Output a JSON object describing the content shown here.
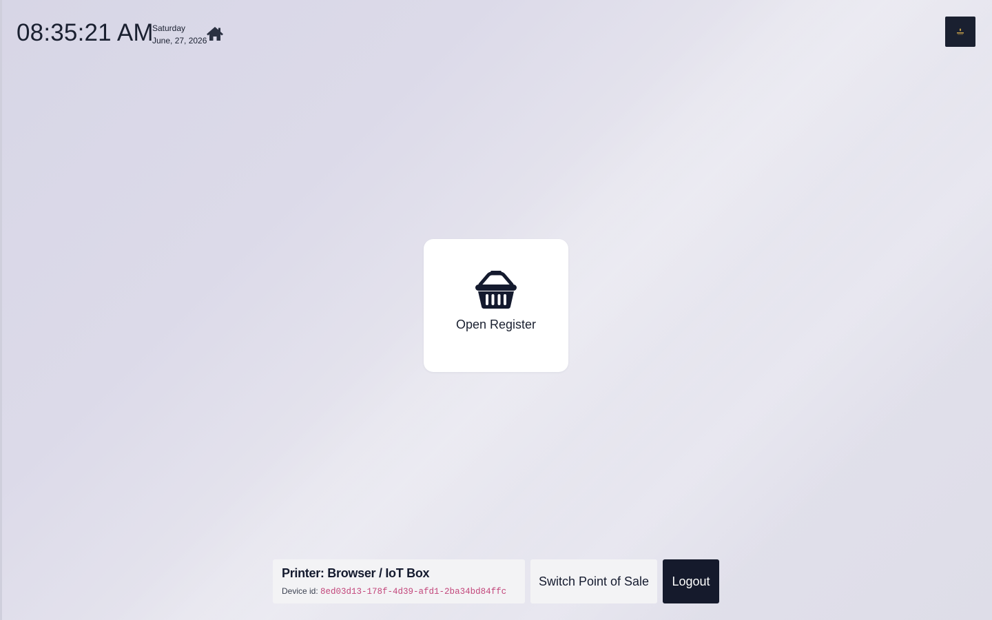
{
  "header": {
    "time": "08:35:21 AM",
    "weekday": "Saturday",
    "date": "June, 27, 2026",
    "home_icon": "home-icon",
    "logo_icon": "company-logo"
  },
  "main": {
    "open_register_label": "Open Register",
    "open_register_icon": "basket-icon"
  },
  "footer": {
    "printer_title": "Printer: Browser / IoT Box",
    "device_id_label": "Device id:",
    "device_id_value": "8ed03d13-178f-4d39-afd1-2ba34bd84ffc",
    "switch_pos_label": "Switch Point of Sale",
    "logout_label": "Logout"
  },
  "colors": {
    "primary_dark": "#151a2c",
    "device_id_accent": "#c2457a",
    "card_bg": "#ffffff",
    "button_light_bg": "#f3f3f5"
  }
}
